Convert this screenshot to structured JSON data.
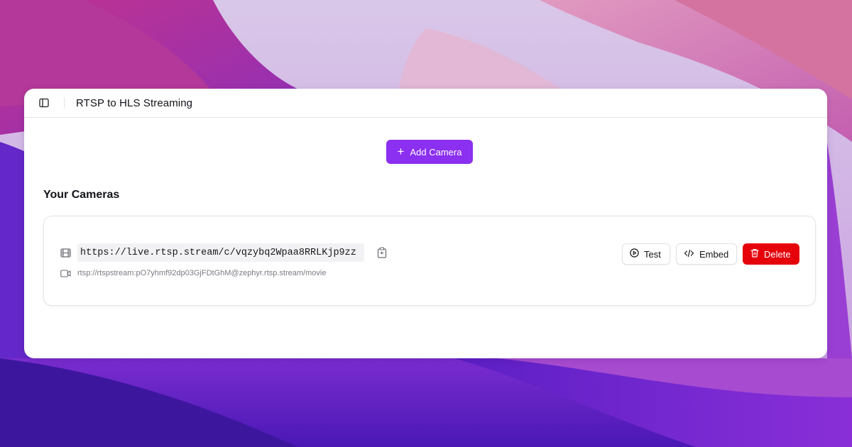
{
  "colors": {
    "accent": "#8b2ff0",
    "danger": "#e5020b",
    "text": "#111318",
    "muted": "#7b7b84",
    "code_bg": "#f2f2f4"
  },
  "window": {
    "title": "RTSP to HLS Streaming",
    "sidebar_toggle_icon": "sidebar-panel-icon"
  },
  "main": {
    "add_camera_label": "Add Camera",
    "add_camera_icon": "plus-icon",
    "section_title": "Your Cameras"
  },
  "cameras": [
    {
      "stream_url": "https://live.rtsp.stream/c/vqzybq2Wpaa8RRLKjp9zz",
      "rtsp_url": "rtsp://rtspstream:pO7yhmf92dp03GjFDtGhM@zephyr.rtsp.stream/movie",
      "actions": {
        "test_label": "Test",
        "embed_label": "Embed",
        "delete_label": "Delete"
      },
      "icons": {
        "stream": "film-icon",
        "copy": "clipboard-copy-icon",
        "source": "video-camera-icon",
        "test": "play-circle-icon",
        "embed": "code-icon",
        "delete": "trash-icon"
      }
    }
  ]
}
